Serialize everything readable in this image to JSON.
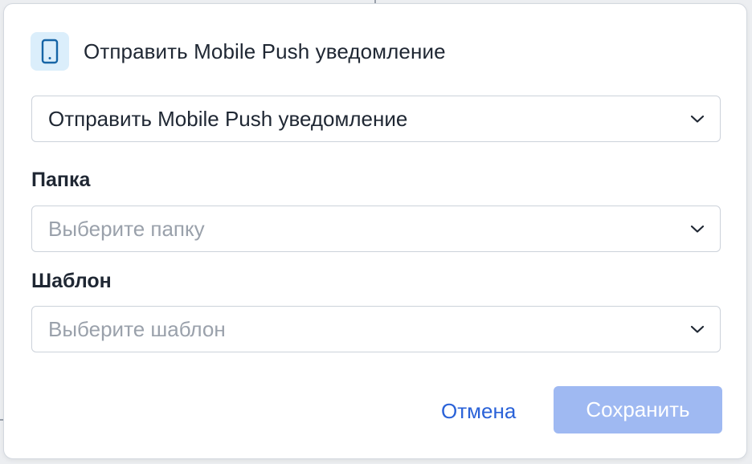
{
  "dialog": {
    "title": "Отправить Mobile Push уведомление",
    "icon": "mobile-phone-icon",
    "accent_color": "#2a62d8"
  },
  "action_select": {
    "value": "Отправить Mobile Push уведомление"
  },
  "folder": {
    "label": "Папка",
    "placeholder": "Выберите папку"
  },
  "template": {
    "label": "Шаблон",
    "placeholder": "Выберите шаблон"
  },
  "footer": {
    "cancel_label": "Отмена",
    "save_label": "Сохранить",
    "save_color": "#9fb9f2"
  }
}
